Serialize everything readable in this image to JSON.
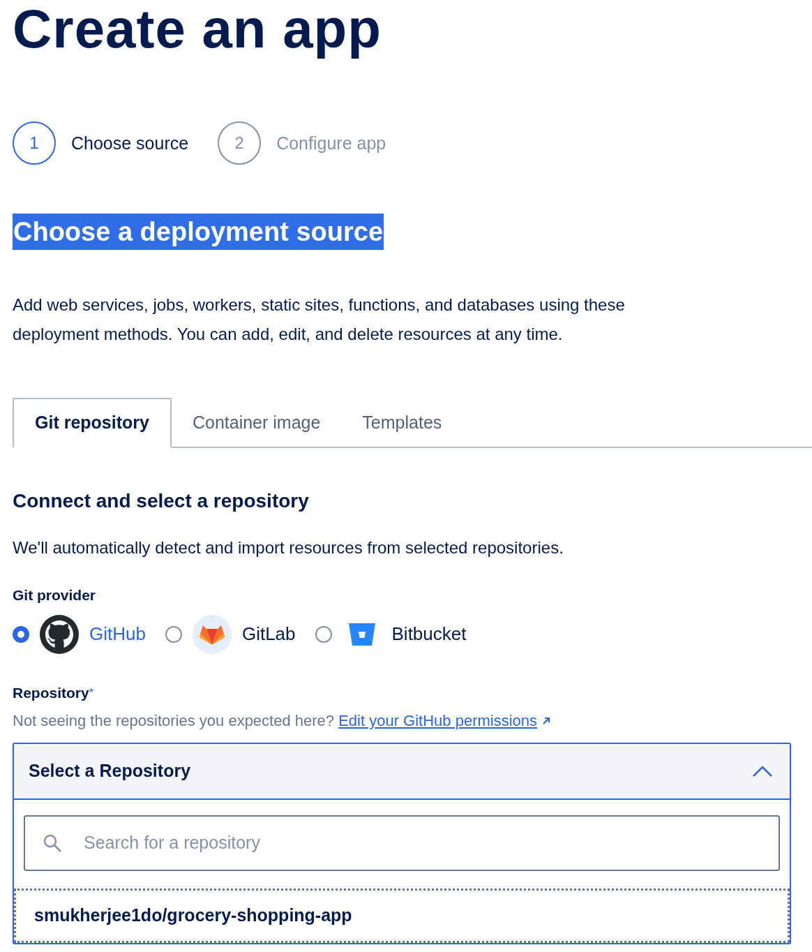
{
  "title": "Create an app",
  "steps": [
    {
      "number": "1",
      "label": "Choose source",
      "active": true
    },
    {
      "number": "2",
      "label": "Configure app",
      "active": false
    }
  ],
  "section_title": {
    "text": "Choose a deployment source",
    "highlighted": true
  },
  "description": "Add web services, jobs, workers, static sites, functions, and databases using these deployment methods. You can add, edit, and delete resources at any time.",
  "tabs": [
    {
      "label": "Git repository",
      "selected": true
    },
    {
      "label": "Container image",
      "selected": false
    },
    {
      "label": "Templates",
      "selected": false
    }
  ],
  "subheading": "Connect and select a repository",
  "subtext": "We'll automatically detect and import resources from selected repositories.",
  "git_provider": {
    "label": "Git provider",
    "options": [
      {
        "kind": "github",
        "name": "GitHub",
        "selected": true
      },
      {
        "kind": "gitlab",
        "name": "GitLab",
        "selected": false
      },
      {
        "kind": "bitbucket",
        "name": "Bitbucket",
        "selected": false
      }
    ]
  },
  "repository": {
    "label": "Repository",
    "required_mark": "*",
    "hint": "Not seeing the repositories you expected here?",
    "link": "Edit your GitHub permissions"
  },
  "dropdown": {
    "value": "Select a Repository",
    "expanded": true,
    "search_placeholder": "Search for a repository",
    "options": [
      {
        "label": "smukherjee1do/grocery-shopping-app",
        "focused": true
      }
    ]
  }
}
